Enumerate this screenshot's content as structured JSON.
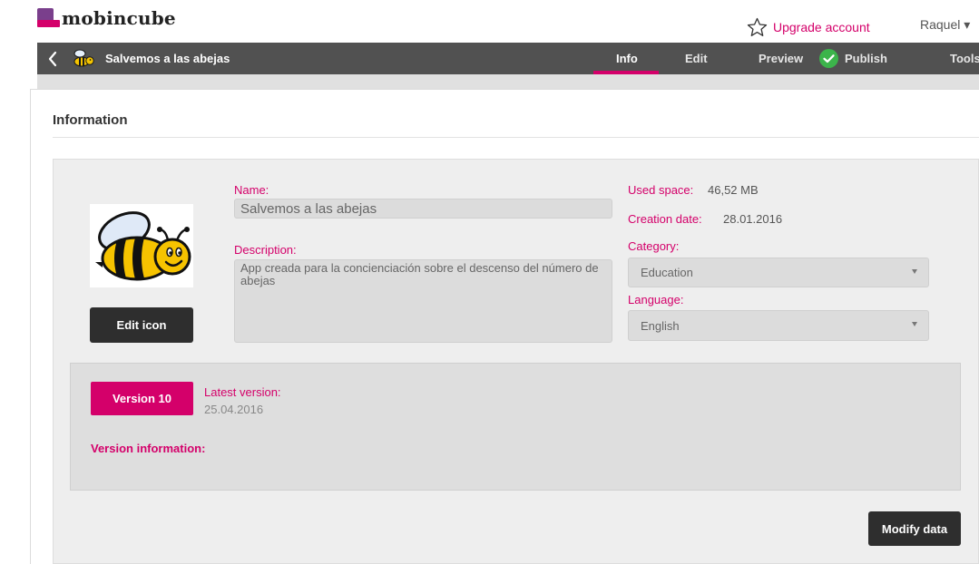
{
  "brand": {
    "name": "mobincube"
  },
  "header": {
    "upgrade_label": "Upgrade account",
    "user_name": "Raquel ▾"
  },
  "nav": {
    "app_name": "Salvemos a las abejas",
    "items": [
      {
        "label": "Info",
        "active": true
      },
      {
        "label": "Edit",
        "active": false
      },
      {
        "label": "Preview",
        "active": false
      },
      {
        "label": "Publish",
        "active": false
      },
      {
        "label": "Tools",
        "active": false
      }
    ]
  },
  "section": {
    "title": "Information"
  },
  "app_info": {
    "edit_icon_label": "Edit icon",
    "name_label": "Name:",
    "name_value": "Salvemos a las abejas",
    "description_label": "Description:",
    "description_value": "App creada para la concienciación sobre el descenso del número de abejas",
    "used_space_label": "Used space:",
    "used_space_value": "46,52 MB",
    "creation_date_label": "Creation date:",
    "creation_date_value": "28.01.2016",
    "category_label": "Category:",
    "category_value": "Education",
    "language_label": "Language:",
    "language_value": "English"
  },
  "version": {
    "button_label": "Version 10",
    "latest_label": "Latest version:",
    "latest_date": "25.04.2016",
    "info_label": "Version information:"
  },
  "modify_label": "Modify data",
  "colors": {
    "accent": "#d4006a",
    "navbar": "#515151",
    "dark_button": "#2e2e2e",
    "success": "#3cb44b",
    "brand_purple": "#7a3f8c"
  },
  "icons": [
    "logo-mark",
    "star-outline-icon",
    "chevron-left-icon",
    "bee-app-icon",
    "check-circle-icon",
    "dropdown-arrow-icon"
  ]
}
